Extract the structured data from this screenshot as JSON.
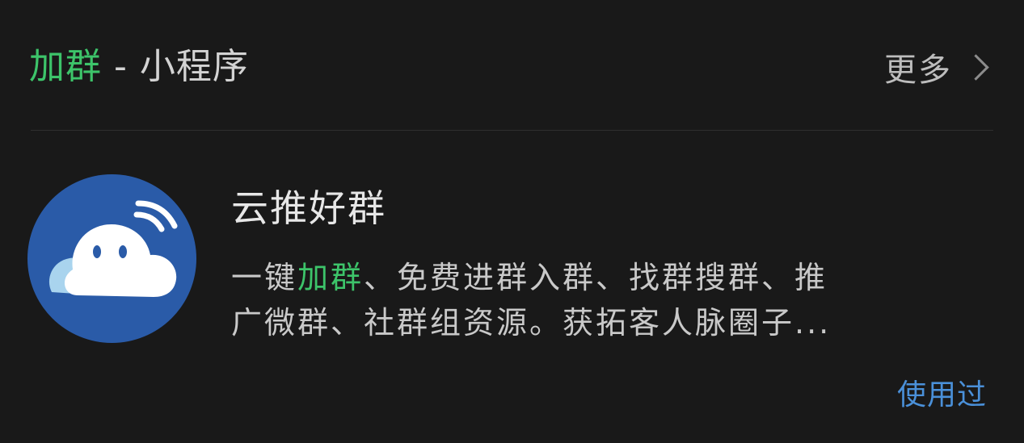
{
  "header": {
    "keyword": "加群",
    "separator": " - ",
    "category": "小程序",
    "more_label": "更多"
  },
  "result": {
    "icon": "cloud-signal-icon",
    "name": "云推好群",
    "description": {
      "line1_prefix": "一键",
      "line1_keyword": "加群",
      "line1_suffix": "、免费进群入群、找群搜群、推",
      "line2": "广微群、社群组资源。获拓客人脉圈子..."
    },
    "status": "使用过"
  },
  "colors": {
    "background": "#191919",
    "highlight": "#3dc46a",
    "link": "#4a90d9",
    "icon_bg": "#2a5ba8"
  }
}
